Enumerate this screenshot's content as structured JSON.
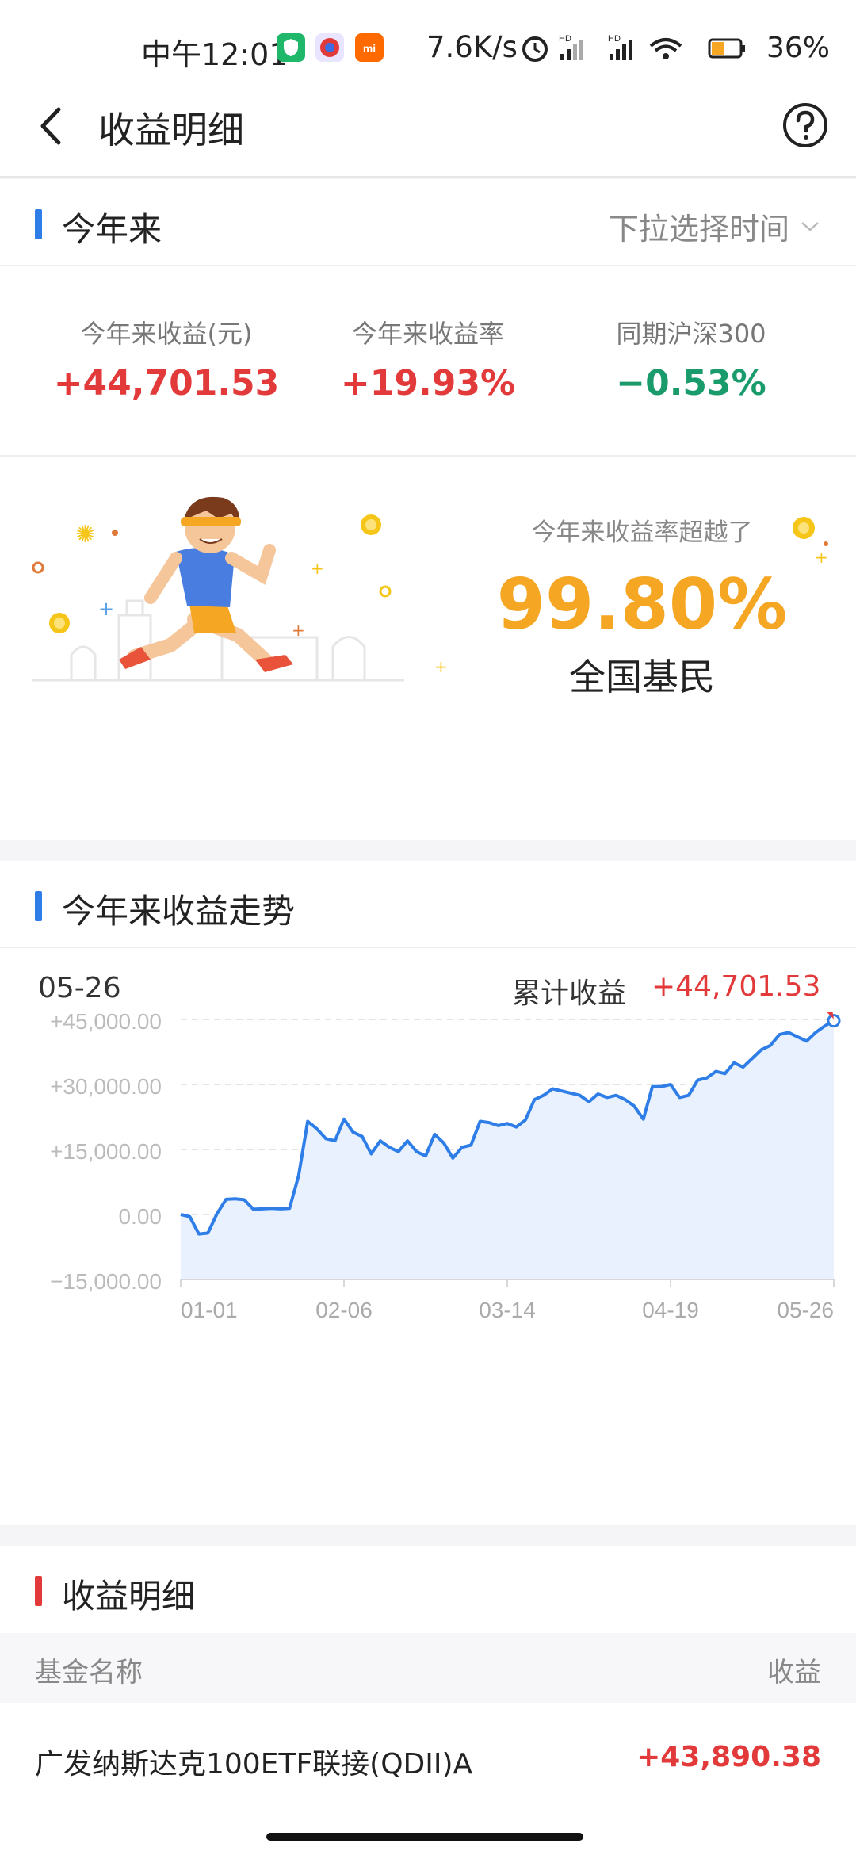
{
  "status": {
    "time": "中午12:01",
    "speed": "7.6K/s",
    "battery": "36%"
  },
  "header": {
    "title": "收益明细"
  },
  "ytd": {
    "title": "今年来",
    "dropdown": "下拉选择时间",
    "stats": [
      {
        "label": "今年来收益(元)",
        "value": "+44,701.53",
        "color": "#e23a3a"
      },
      {
        "label": "今年来收益率",
        "value": "+19.93%",
        "color": "#e23a3a"
      },
      {
        "label": "同期沪深300",
        "value": "−0.53%",
        "color": "#1a9b6b"
      }
    ],
    "promo": {
      "label": "今年来收益率超越了",
      "percent": "99.80%",
      "subtitle": "全国基民"
    }
  },
  "trend": {
    "title": "今年来收益走势",
    "date": "05-26",
    "cumulative_label": "累计收益",
    "cumulative_value": "+44,701.53"
  },
  "chart_data": {
    "type": "area",
    "x": [
      "01-01",
      "01-03",
      "01-05",
      "01-07",
      "01-09",
      "01-11",
      "01-13",
      "01-15",
      "01-17",
      "01-19",
      "01-21",
      "01-23",
      "01-25",
      "01-27",
      "01-29",
      "01-31",
      "02-02",
      "02-04",
      "02-06",
      "02-08",
      "02-10",
      "02-12",
      "02-14",
      "02-16",
      "02-18",
      "02-20",
      "02-22",
      "02-24",
      "02-26",
      "02-28",
      "03-02",
      "03-04",
      "03-06",
      "03-08",
      "03-10",
      "03-12",
      "03-14",
      "03-16",
      "03-18",
      "03-20",
      "03-22",
      "03-24",
      "03-26",
      "03-28",
      "03-30",
      "04-01",
      "04-03",
      "04-05",
      "04-07",
      "04-09",
      "04-11",
      "04-13",
      "04-15",
      "04-17",
      "04-19",
      "04-21",
      "04-23",
      "04-25",
      "04-27",
      "04-29",
      "05-01",
      "05-03",
      "05-05",
      "05-07",
      "05-09",
      "05-11",
      "05-13",
      "05-15",
      "05-17",
      "05-19",
      "05-21",
      "05-23",
      "05-26"
    ],
    "values": [
      0,
      -500,
      -4500,
      -4300,
      200,
      3500,
      3600,
      3400,
      1200,
      1300,
      1400,
      1300,
      1400,
      9000,
      21500,
      19800,
      17500,
      17000,
      22000,
      19000,
      18000,
      14000,
      17000,
      15500,
      14500,
      17000,
      14500,
      13500,
      18500,
      16500,
      13000,
      15500,
      16000,
      21500,
      21200,
      20500,
      21000,
      20200,
      21800,
      26500,
      27500,
      29000,
      28500,
      28000,
      27500,
      26000,
      27800,
      27000,
      27500,
      26500,
      25000,
      22000,
      29500,
      29500,
      30000,
      27000,
      27500,
      31000,
      31500,
      33000,
      32500,
      35000,
      34000,
      36000,
      38000,
      39000,
      41500,
      42000,
      41000,
      40000,
      42000,
      43500,
      44701.53
    ],
    "xticks": [
      "01-01",
      "02-06",
      "03-14",
      "04-19",
      "05-26"
    ],
    "yticks": [
      "+45,000.00",
      "+30,000.00",
      "+15,000.00",
      "0.00",
      "−15,000.00"
    ],
    "ylim": [
      -15000,
      45000
    ],
    "tooltip": "+44,701.53",
    "line_color": "#2f7ee8",
    "fill_color": "#e6f0fd"
  },
  "detail": {
    "title": "收益明细",
    "col_name": "基金名称",
    "col_value": "收益",
    "rows": [
      {
        "name": "广发纳斯达克100ETF联接(QDII)A",
        "value": "+43,890.38"
      }
    ]
  }
}
